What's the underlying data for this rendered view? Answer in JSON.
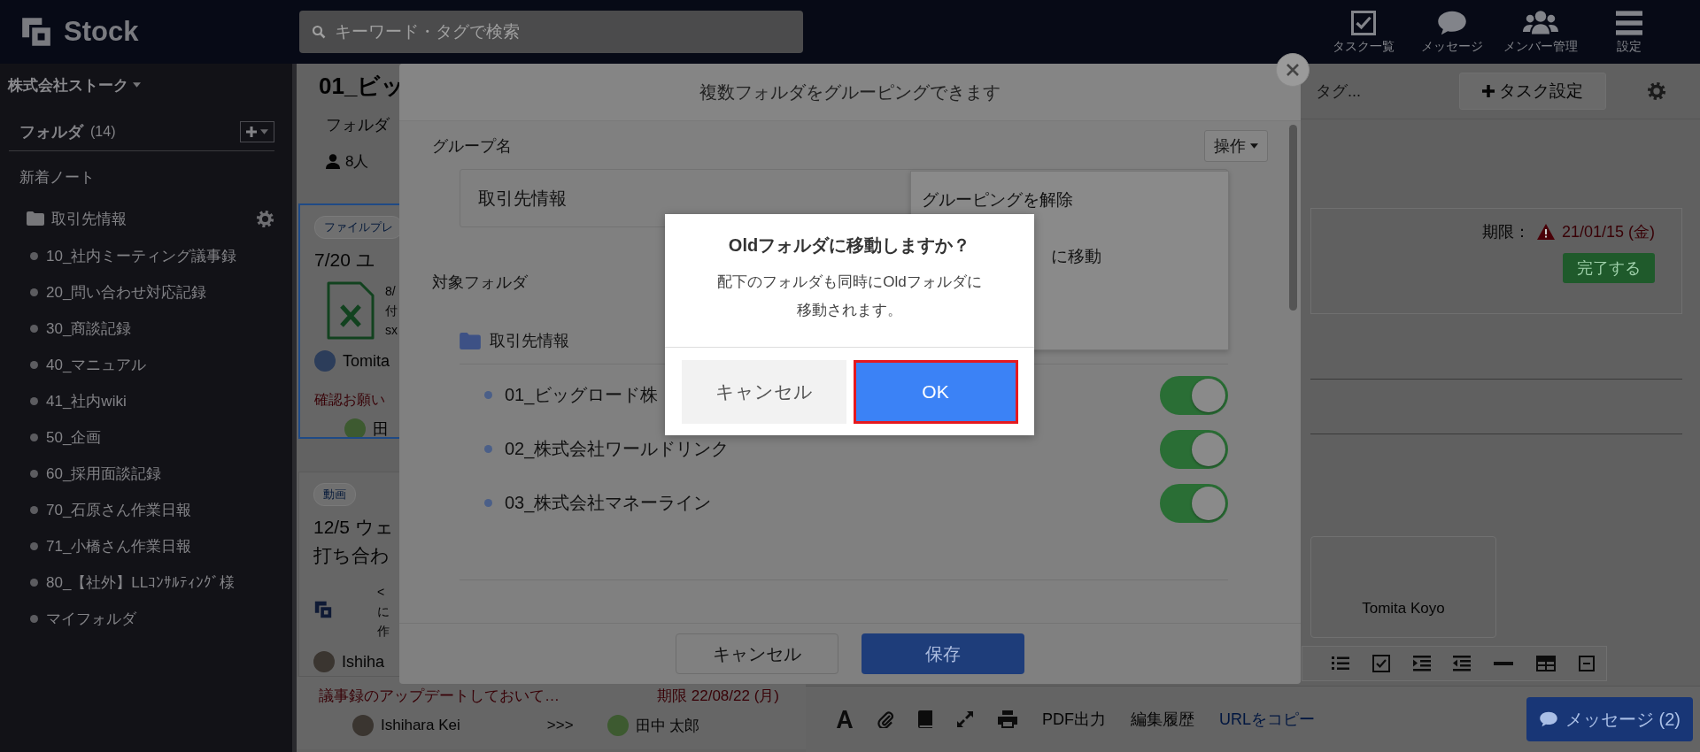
{
  "header": {
    "logo": "Stock",
    "search": {
      "placeholder": "キーワード・タグで検索"
    },
    "nav": [
      "タスク一覧",
      "メッセージ",
      "メンバー管理",
      "設定"
    ]
  },
  "sidebar": {
    "company": "株式会社ストーク",
    "folders_label": "フォルダ",
    "folders_count": "(14)",
    "new_notes": "新着ノート",
    "group": "取引先情報",
    "items": [
      "10_社内ミーティング議事録",
      "20_問い合わせ対応記録",
      "30_商談記録",
      "40_マニュアル",
      "41_社内wiki",
      "50_企画",
      "60_採用面談記録",
      "70_石原さん作業日報",
      "71_小橋さん作業日報",
      "80_【社外】LLｺﾝｻﾙﾃｨﾝｸﾞ様",
      "マイフォルダ"
    ]
  },
  "note_list": {
    "title": "01_ビッ",
    "subtitle": "フォルダ",
    "members": "8人",
    "cards": [
      {
        "kind": "file",
        "selected": true,
        "tag": "ファイルプレ",
        "title": "7/20 ユ",
        "lines": [
          "8/",
          "付",
          "sx"
        ],
        "author": "Tomita",
        "comment": "確認お願い",
        "assignee": "田"
      },
      {
        "kind": "logo",
        "selected": false,
        "tag": "動画",
        "title": "12/5 ウェ",
        "title_2": "打ち合わ",
        "lines": [
          "<",
          "に",
          "作"
        ],
        "author": "Ishiha"
      }
    ],
    "task": {
      "text": "議事録のアップデートしておいて…",
      "due": "期限 22/08/22 (月)",
      "from": "Ishihara Kei",
      "arrow": ">>>",
      "to": "田中 太郎"
    }
  },
  "detail": {
    "tag_hint": "タグ...",
    "task_button": "タスク設定",
    "due_label": "期限：",
    "due_date": "21/01/15 (金)",
    "complete": "完了する",
    "person": "Tomita Koyo",
    "tools": [
      {
        "label": "PDF出力",
        "kind": "action"
      },
      {
        "label": "編集履歴",
        "kind": "action"
      },
      {
        "label": "URLをコピー",
        "kind": "link"
      }
    ],
    "message_button": "メッセージ (2)"
  },
  "group_modal": {
    "title": "複数フォルダをグルーピングできます",
    "group_label": "グループ名",
    "actions_button": "操作",
    "group_name": "取引先情報",
    "menu": [
      "グルーピングを解除",
      "に移動"
    ],
    "targets_label": "対象フォルダ",
    "root_folder": "取引先情報",
    "folders": [
      {
        "name": "01_ビッグロード株",
        "on": true
      },
      {
        "name": "02_株式会社ワールドリンク",
        "on": true
      },
      {
        "name": "03_株式会社マネーライン",
        "on": true
      }
    ],
    "cancel": "キャンセル",
    "save": "保存"
  },
  "confirm": {
    "title": "Oldフォルダに移動しますか？",
    "message": "配下のフォルダも同時にOldフォルダに移動されます。",
    "cancel": "キャンセル",
    "ok": "OK",
    "ok_highlighted": true
  }
}
